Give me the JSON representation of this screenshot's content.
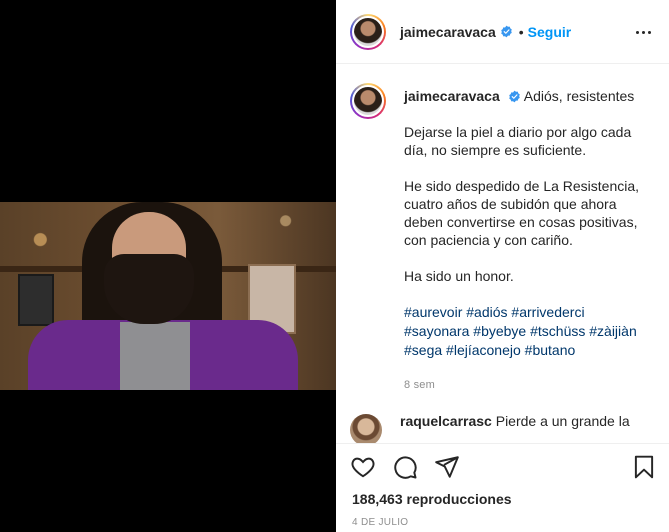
{
  "post": {
    "author": "jaimecaravaca",
    "follow_label": "Seguir",
    "separator": "•"
  },
  "caption": {
    "author": "jaimecaravaca",
    "title": "Adiós, resistentes",
    "paragraphs": [
      "Dejarse la piel a diario por algo cada día, no siempre es suficiente.",
      "He sido despedido de La Resistencia, cuatro años de subidón que ahora deben convertirse en cosas positivas, con paciencia y con cariño.",
      "Ha sido un honor."
    ],
    "hashtags": [
      "#aurevoir",
      "#adiós",
      "#arrivederci",
      "#sayonara",
      "#byebye",
      "#tschüss",
      "#zàijiàn",
      "#sega",
      "#lejíaconejo",
      "#butano"
    ],
    "time_ago": "8 sem"
  },
  "comments": [
    {
      "author": "raquelcarrasc",
      "text": "Pierde a un grande la"
    }
  ],
  "stats": {
    "views": "188,463 reproducciones",
    "date": "4 DE JULIO"
  },
  "icons": {
    "like": "heart-icon",
    "comment": "comment-icon",
    "share": "send-icon",
    "save": "bookmark-icon",
    "more": "more-options-icon",
    "verified": "verified-badge-icon"
  },
  "colors": {
    "link_blue": "#0095f6",
    "hashtag": "#00376b",
    "verified": "#3897f0",
    "muted": "#8e8e8e",
    "text": "#262626"
  }
}
